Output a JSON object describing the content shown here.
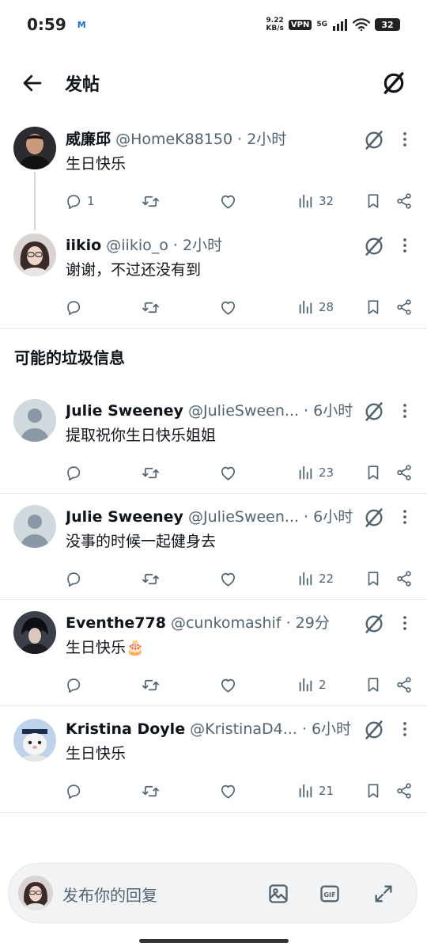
{
  "status_bar": {
    "time": "0:59",
    "net_speed_value": "9.22",
    "net_speed_unit": "KB/s",
    "vpn": "VPN",
    "network": "5G",
    "battery": "32"
  },
  "header": {
    "title": "发帖"
  },
  "posts": [
    {
      "author": "威廉邱",
      "handle": "@HomeK88150 · 2小时",
      "text": "生日快乐",
      "replies": "1",
      "views": "32"
    },
    {
      "author": "iikio",
      "handle": "@iikio_o · 2小时",
      "text": "谢谢，不过还没有到",
      "replies": "",
      "views": "28"
    }
  ],
  "spam_section": {
    "title": "可能的垃圾信息"
  },
  "spam_posts": [
    {
      "author": "Julie Sweeney",
      "handle": "@JulieSween... · 6小时",
      "text": "提取祝你生日快乐姐姐",
      "views": "23"
    },
    {
      "author": "Julie Sweeney",
      "handle": "@JulieSween... · 6小时",
      "text": "没事的时候一起健身去",
      "views": "22"
    },
    {
      "author": "Eventhe778",
      "handle": "@cunkomashif · 29分",
      "text": "生日快乐🎂",
      "views": "2"
    },
    {
      "author": "Kristina Doyle",
      "handle": "@KristinaD4... · 6小时",
      "text": "生日快乐",
      "views": "21"
    }
  ],
  "reply_bar": {
    "placeholder": "发布你的回复"
  },
  "colors": {
    "text": "#0f1419",
    "secondary": "#536471",
    "divider": "#e6e9ec"
  }
}
